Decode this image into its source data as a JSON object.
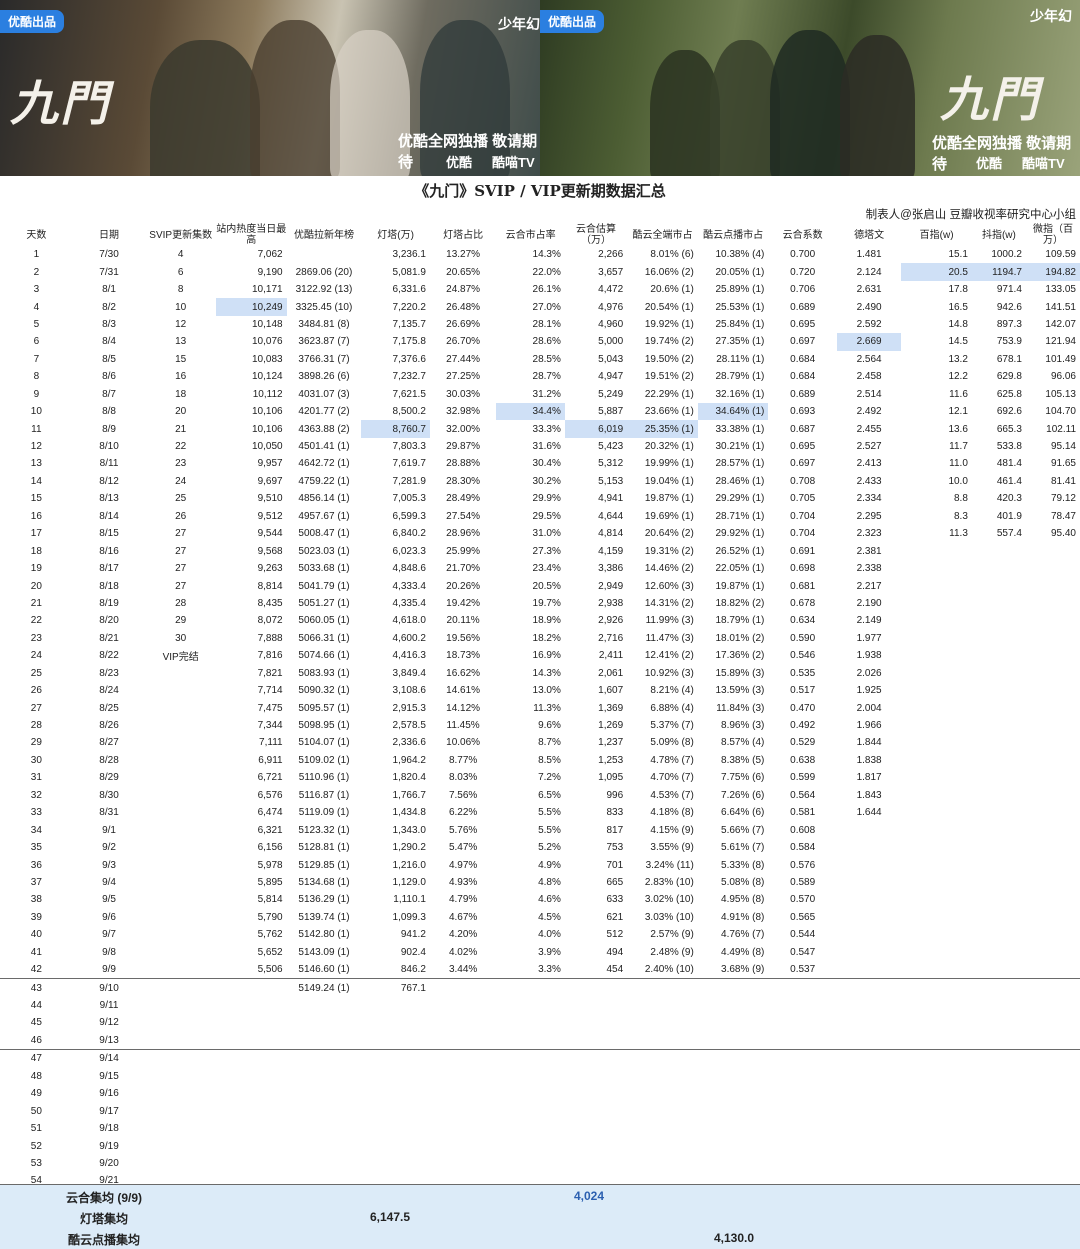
{
  "banner": {
    "left": {
      "tag": "优酷出品",
      "brand": "少年幻",
      "title_art": "九門",
      "slogan": "优酷全网独播 敬请期待",
      "platform1": "优酷",
      "platform2": "酷喵TV"
    },
    "right": {
      "tag": "优酷出品",
      "brand": "少年幻",
      "title_art": "九門",
      "slogan": "优酷全网独播 敬请期待",
      "platform1": "优酷",
      "platform2": "酷喵TV"
    }
  },
  "title": "《九门》SVIP / VIP更新期数据汇总",
  "author": "制表人@张启山 豆瓣收视率研究中心小组",
  "headers": [
    "天数",
    "日期",
    "SVIP更新集数",
    "站内热度当日最高",
    "优酷拉新年榜",
    "灯塔(万)",
    "灯塔占比",
    "云合市占率",
    "云合估算（万）",
    "酷云全端市占",
    "酷云点播市占",
    "云合系数",
    "德塔文",
    "百指(w)",
    "抖指(w)",
    "微指（百万）"
  ],
  "rows": [
    [
      "1",
      "7/30",
      "4",
      "7,062",
      "",
      "3,236.1",
      "13.27%",
      "14.3%",
      "2,266",
      "8.01% (6)",
      "10.38% (4)",
      "0.700",
      "1.481",
      "15.1",
      "1000.2",
      "109.59"
    ],
    [
      "2",
      "7/31",
      "6",
      "9,190",
      "2869.06 (20)",
      "5,081.9",
      "20.65%",
      "22.0%",
      "3,657",
      "16.06% (2)",
      "20.05% (1)",
      "0.720",
      "2.124",
      "20.5",
      "1194.7",
      "194.82"
    ],
    [
      "3",
      "8/1",
      "8",
      "10,171",
      "3122.92 (13)",
      "6,331.6",
      "24.87%",
      "26.1%",
      "4,472",
      "20.6% (1)",
      "25.89% (1)",
      "0.706",
      "2.631",
      "17.8",
      "971.4",
      "133.05"
    ],
    [
      "4",
      "8/2",
      "10",
      "10,249",
      "3325.45 (10)",
      "7,220.2",
      "26.48%",
      "27.0%",
      "4,976",
      "20.54% (1)",
      "25.53% (1)",
      "0.689",
      "2.490",
      "16.5",
      "942.6",
      "141.51"
    ],
    [
      "5",
      "8/3",
      "12",
      "10,148",
      "3484.81 (8)",
      "7,135.7",
      "26.69%",
      "28.1%",
      "4,960",
      "19.92% (1)",
      "25.84% (1)",
      "0.695",
      "2.592",
      "14.8",
      "897.3",
      "142.07"
    ],
    [
      "6",
      "8/4",
      "13",
      "10,076",
      "3623.87 (7)",
      "7,175.8",
      "26.70%",
      "28.6%",
      "5,000",
      "19.74% (2)",
      "27.35% (1)",
      "0.697",
      "2.669",
      "14.5",
      "753.9",
      "121.94"
    ],
    [
      "7",
      "8/5",
      "15",
      "10,083",
      "3766.31 (7)",
      "7,376.6",
      "27.44%",
      "28.5%",
      "5,043",
      "19.50% (2)",
      "28.11% (1)",
      "0.684",
      "2.564",
      "13.2",
      "678.1",
      "101.49"
    ],
    [
      "8",
      "8/6",
      "16",
      "10,124",
      "3898.26 (6)",
      "7,232.7",
      "27.25%",
      "28.7%",
      "4,947",
      "19.51% (2)",
      "28.79% (1)",
      "0.684",
      "2.458",
      "12.2",
      "629.8",
      "96.06"
    ],
    [
      "9",
      "8/7",
      "18",
      "10,112",
      "4031.07 (3)",
      "7,621.5",
      "30.03%",
      "31.2%",
      "5,249",
      "22.29% (1)",
      "32.16% (1)",
      "0.689",
      "2.514",
      "11.6",
      "625.8",
      "105.13"
    ],
    [
      "10",
      "8/8",
      "20",
      "10,106",
      "4201.77 (2)",
      "8,500.2",
      "32.98%",
      "34.4%",
      "5,887",
      "23.66% (1)",
      "34.64% (1)",
      "0.693",
      "2.492",
      "12.1",
      "692.6",
      "104.70"
    ],
    [
      "11",
      "8/9",
      "21",
      "10,106",
      "4363.88 (2)",
      "8,760.7",
      "32.00%",
      "33.3%",
      "6,019",
      "25.35% (1)",
      "33.38% (1)",
      "0.687",
      "2.455",
      "13.6",
      "665.3",
      "102.11"
    ],
    [
      "12",
      "8/10",
      "22",
      "10,050",
      "4501.41 (1)",
      "7,803.3",
      "29.87%",
      "31.6%",
      "5,423",
      "20.32% (1)",
      "30.21% (1)",
      "0.695",
      "2.527",
      "11.7",
      "533.8",
      "95.14"
    ],
    [
      "13",
      "8/11",
      "23",
      "9,957",
      "4642.72 (1)",
      "7,619.7",
      "28.88%",
      "30.4%",
      "5,312",
      "19.99% (1)",
      "28.57% (1)",
      "0.697",
      "2.413",
      "11.0",
      "481.4",
      "91.65"
    ],
    [
      "14",
      "8/12",
      "24",
      "9,697",
      "4759.22 (1)",
      "7,281.9",
      "28.30%",
      "30.2%",
      "5,153",
      "19.04% (1)",
      "28.46% (1)",
      "0.708",
      "2.433",
      "10.0",
      "461.4",
      "81.41"
    ],
    [
      "15",
      "8/13",
      "25",
      "9,510",
      "4856.14 (1)",
      "7,005.3",
      "28.49%",
      "29.9%",
      "4,941",
      "19.87% (1)",
      "29.29% (1)",
      "0.705",
      "2.334",
      "8.8",
      "420.3",
      "79.12"
    ],
    [
      "16",
      "8/14",
      "26",
      "9,512",
      "4957.67 (1)",
      "6,599.3",
      "27.54%",
      "29.5%",
      "4,644",
      "19.69% (1)",
      "28.71% (1)",
      "0.704",
      "2.295",
      "8.3",
      "401.9",
      "78.47"
    ],
    [
      "17",
      "8/15",
      "27",
      "9,544",
      "5008.47 (1)",
      "6,840.2",
      "28.96%",
      "31.0%",
      "4,814",
      "20.64% (2)",
      "29.92% (1)",
      "0.704",
      "2.323",
      "11.3",
      "557.4",
      "95.40"
    ],
    [
      "18",
      "8/16",
      "27",
      "9,568",
      "5023.03 (1)",
      "6,023.3",
      "25.99%",
      "27.3%",
      "4,159",
      "19.31% (2)",
      "26.52% (1)",
      "0.691",
      "2.381",
      "",
      "",
      ""
    ],
    [
      "19",
      "8/17",
      "27",
      "9,263",
      "5033.68 (1)",
      "4,848.6",
      "21.70%",
      "23.4%",
      "3,386",
      "14.46% (2)",
      "22.05% (1)",
      "0.698",
      "2.338",
      "",
      "",
      ""
    ],
    [
      "20",
      "8/18",
      "27",
      "8,814",
      "5041.79 (1)",
      "4,333.4",
      "20.26%",
      "20.5%",
      "2,949",
      "12.60% (3)",
      "19.87% (1)",
      "0.681",
      "2.217",
      "",
      "",
      ""
    ],
    [
      "21",
      "8/19",
      "28",
      "8,435",
      "5051.27 (1)",
      "4,335.4",
      "19.42%",
      "19.7%",
      "2,938",
      "14.31% (2)",
      "18.82% (2)",
      "0.678",
      "2.190",
      "",
      "",
      ""
    ],
    [
      "22",
      "8/20",
      "29",
      "8,072",
      "5060.05 (1)",
      "4,618.0",
      "20.11%",
      "18.9%",
      "2,926",
      "11.99% (3)",
      "18.79% (1)",
      "0.634",
      "2.149",
      "",
      "",
      ""
    ],
    [
      "23",
      "8/21",
      "30",
      "7,888",
      "5066.31 (1)",
      "4,600.2",
      "19.56%",
      "18.2%",
      "2,716",
      "11.47% (3)",
      "18.01% (2)",
      "0.590",
      "1.977",
      "",
      "",
      ""
    ],
    [
      "24",
      "8/22",
      "VIP完结",
      "7,816",
      "5074.66 (1)",
      "4,416.3",
      "18.73%",
      "16.9%",
      "2,411",
      "12.41% (2)",
      "17.36% (2)",
      "0.546",
      "1.938",
      "",
      "",
      ""
    ],
    [
      "25",
      "8/23",
      "",
      "7,821",
      "5083.93 (1)",
      "3,849.4",
      "16.62%",
      "14.3%",
      "2,061",
      "10.92% (3)",
      "15.89% (3)",
      "0.535",
      "2.026",
      "",
      "",
      ""
    ],
    [
      "26",
      "8/24",
      "",
      "7,714",
      "5090.32 (1)",
      "3,108.6",
      "14.61%",
      "13.0%",
      "1,607",
      "8.21% (4)",
      "13.59% (3)",
      "0.517",
      "1.925",
      "",
      "",
      ""
    ],
    [
      "27",
      "8/25",
      "",
      "7,475",
      "5095.57 (1)",
      "2,915.3",
      "14.12%",
      "11.3%",
      "1,369",
      "6.88% (4)",
      "11.84% (3)",
      "0.470",
      "2.004",
      "",
      "",
      ""
    ],
    [
      "28",
      "8/26",
      "",
      "7,344",
      "5098.95 (1)",
      "2,578.5",
      "11.45%",
      "9.6%",
      "1,269",
      "5.37% (7)",
      "8.96% (3)",
      "0.492",
      "1.966",
      "",
      "",
      ""
    ],
    [
      "29",
      "8/27",
      "",
      "7,111",
      "5104.07 (1)",
      "2,336.6",
      "10.06%",
      "8.7%",
      "1,237",
      "5.09% (8)",
      "8.57% (4)",
      "0.529",
      "1.844",
      "",
      "",
      ""
    ],
    [
      "30",
      "8/28",
      "",
      "6,911",
      "5109.02 (1)",
      "1,964.2",
      "8.77%",
      "8.5%",
      "1,253",
      "4.78% (7)",
      "8.38% (5)",
      "0.638",
      "1.838",
      "",
      "",
      ""
    ],
    [
      "31",
      "8/29",
      "",
      "6,721",
      "5110.96 (1)",
      "1,820.4",
      "8.03%",
      "7.2%",
      "1,095",
      "4.70% (7)",
      "7.75% (6)",
      "0.599",
      "1.817",
      "",
      "",
      ""
    ],
    [
      "32",
      "8/30",
      "",
      "6,576",
      "5116.87 (1)",
      "1,766.7",
      "7.56%",
      "6.5%",
      "996",
      "4.53% (7)",
      "7.26% (6)",
      "0.564",
      "1.843",
      "",
      "",
      ""
    ],
    [
      "33",
      "8/31",
      "",
      "6,474",
      "5119.09 (1)",
      "1,434.8",
      "6.22%",
      "5.5%",
      "833",
      "4.18% (8)",
      "6.64% (6)",
      "0.581",
      "1.644",
      "",
      "",
      ""
    ],
    [
      "34",
      "9/1",
      "",
      "6,321",
      "5123.32 (1)",
      "1,343.0",
      "5.76%",
      "5.5%",
      "817",
      "4.15% (9)",
      "5.66% (7)",
      "0.608",
      "",
      "",
      "",
      ""
    ],
    [
      "35",
      "9/2",
      "",
      "6,156",
      "5128.81 (1)",
      "1,290.2",
      "5.47%",
      "5.2%",
      "753",
      "3.55% (9)",
      "5.61% (7)",
      "0.584",
      "",
      "",
      "",
      ""
    ],
    [
      "36",
      "9/3",
      "",
      "5,978",
      "5129.85 (1)",
      "1,216.0",
      "4.97%",
      "4.9%",
      "701",
      "3.24% (11)",
      "5.33% (8)",
      "0.576",
      "",
      "",
      "",
      ""
    ],
    [
      "37",
      "9/4",
      "",
      "5,895",
      "5134.68 (1)",
      "1,129.0",
      "4.93%",
      "4.8%",
      "665",
      "2.83% (10)",
      "5.08% (8)",
      "0.589",
      "",
      "",
      "",
      ""
    ],
    [
      "38",
      "9/5",
      "",
      "5,814",
      "5136.29 (1)",
      "1,110.1",
      "4.79%",
      "4.6%",
      "633",
      "3.02% (10)",
      "4.95% (8)",
      "0.570",
      "",
      "",
      "",
      ""
    ],
    [
      "39",
      "9/6",
      "",
      "5,790",
      "5139.74 (1)",
      "1,099.3",
      "4.67%",
      "4.5%",
      "621",
      "3.03% (10)",
      "4.91% (8)",
      "0.565",
      "",
      "",
      "",
      ""
    ],
    [
      "40",
      "9/7",
      "",
      "5,762",
      "5142.80 (1)",
      "941.2",
      "4.20%",
      "4.0%",
      "512",
      "2.57% (9)",
      "4.76% (7)",
      "0.544",
      "",
      "",
      "",
      ""
    ],
    [
      "41",
      "9/8",
      "",
      "5,652",
      "5143.09 (1)",
      "902.4",
      "4.02%",
      "3.9%",
      "494",
      "2.48% (9)",
      "4.49% (8)",
      "0.547",
      "",
      "",
      "",
      ""
    ],
    [
      "42",
      "9/9",
      "",
      "5,506",
      "5146.60 (1)",
      "846.2",
      "3.44%",
      "3.3%",
      "454",
      "2.40% (10)",
      "3.68% (9)",
      "0.537",
      "",
      "",
      "",
      ""
    ],
    [
      "43",
      "9/10",
      "",
      "",
      "5149.24 (1)",
      "767.1",
      "",
      "",
      "",
      "",
      "",
      "",
      "",
      "",
      "",
      ""
    ],
    [
      "44",
      "9/11",
      "",
      "",
      "",
      "",
      "",
      "",
      "",
      "",
      "",
      "",
      "",
      "",
      "",
      ""
    ],
    [
      "45",
      "9/12",
      "",
      "",
      "",
      "",
      "",
      "",
      "",
      "",
      "",
      "",
      "",
      "",
      "",
      ""
    ],
    [
      "46",
      "9/13",
      "",
      "",
      "",
      "",
      "",
      "",
      "",
      "",
      "",
      "",
      "",
      "",
      "",
      ""
    ],
    [
      "47",
      "9/14",
      "",
      "",
      "",
      "",
      "",
      "",
      "",
      "",
      "",
      "",
      "",
      "",
      "",
      ""
    ],
    [
      "48",
      "9/15",
      "",
      "",
      "",
      "",
      "",
      "",
      "",
      "",
      "",
      "",
      "",
      "",
      "",
      ""
    ],
    [
      "49",
      "9/16",
      "",
      "",
      "",
      "",
      "",
      "",
      "",
      "",
      "",
      "",
      "",
      "",
      "",
      ""
    ],
    [
      "50",
      "9/17",
      "",
      "",
      "",
      "",
      "",
      "",
      "",
      "",
      "",
      "",
      "",
      "",
      "",
      ""
    ],
    [
      "51",
      "9/18",
      "",
      "",
      "",
      "",
      "",
      "",
      "",
      "",
      "",
      "",
      "",
      "",
      "",
      ""
    ],
    [
      "52",
      "9/19",
      "",
      "",
      "",
      "",
      "",
      "",
      "",
      "",
      "",
      "",
      "",
      "",
      "",
      ""
    ],
    [
      "53",
      "9/20",
      "",
      "",
      "",
      "",
      "",
      "",
      "",
      "",
      "",
      "",
      "",
      "",
      "",
      ""
    ],
    [
      "54",
      "9/21",
      "",
      "",
      "",
      "",
      "",
      "",
      "",
      "",
      "",
      "",
      "",
      "",
      "",
      ""
    ]
  ],
  "highlights": [
    [
      1,
      13
    ],
    [
      1,
      14
    ],
    [
      1,
      15
    ],
    [
      3,
      3
    ],
    [
      5,
      12
    ],
    [
      9,
      7
    ],
    [
      9,
      10
    ],
    [
      10,
      5
    ],
    [
      10,
      8
    ],
    [
      10,
      9
    ]
  ],
  "separators_after_row": [
    41,
    45
  ],
  "summary": [
    {
      "label": "云合集均 (9/9)",
      "value": "4,024",
      "color": "#2b5fb0"
    },
    {
      "label": "灯塔集均",
      "value": "6,147.5",
      "color": "#222222"
    },
    {
      "label": "酷云点播集均",
      "value": "4,130.0",
      "color": "#222222"
    }
  ]
}
